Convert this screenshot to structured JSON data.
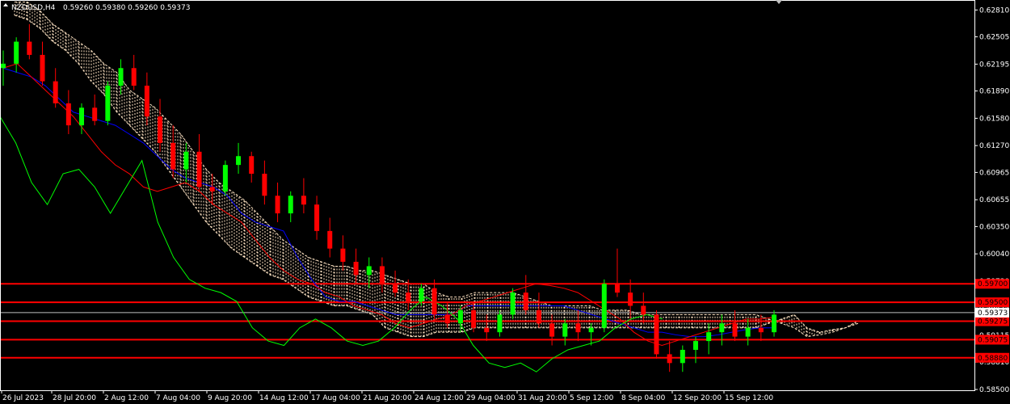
{
  "chart_data": {
    "type": "candlestick",
    "header": {
      "symbol_tf": "NZDUSD,H4",
      "ohlc": "0.59260 0.59380 0.59260 0.59373"
    },
    "y_ticks": [
      "0.62810",
      "0.62505",
      "0.62195",
      "0.61890",
      "0.61580",
      "0.61270",
      "0.60965",
      "0.60655",
      "0.60350",
      "0.60040",
      "0.59730",
      "0.59425",
      "0.59115",
      "0.58810",
      "0.58500"
    ],
    "y_range": [
      0.585,
      0.62905
    ],
    "x_ticks": [
      "26 Jul 2023",
      "28 Jul 20:00",
      "2 Aug 12:00",
      "7 Aug 04:00",
      "9 Aug 20:00",
      "14 Aug 12:00",
      "17 Aug 04:00",
      "21 Aug 20:00",
      "24 Aug 12:00",
      "29 Aug 04:00",
      "31 Aug 20:00",
      "5 Sep 12:00",
      "8 Sep 04:00",
      "12 Sep 20:00",
      "15 Sep 12:00"
    ],
    "current_price": "0.59373",
    "horizontal_levels": [
      {
        "label": "0.59700",
        "value": 0.597
      },
      {
        "label": "0.59500",
        "value": 0.5949
      },
      {
        "label": "0.59275",
        "value": 0.59275
      },
      {
        "label": "0.59075",
        "value": 0.59065
      },
      {
        "label": "0.58880",
        "value": 0.5886
      }
    ],
    "colors": {
      "background": "#000000",
      "bull": "#00ff00",
      "bear": "#ff0000",
      "tenkan": "#ff0000",
      "kijun": "#0000ff",
      "chikou": "#00ff00",
      "cloud": "#ffe4c4",
      "level_line": "#ff0000",
      "label_bg": "#ff0000"
    },
    "tenkan": [
      0.6215,
      0.622,
      0.6205,
      0.619,
      0.6175,
      0.616,
      0.614,
      0.612,
      0.6105,
      0.6095,
      0.608,
      0.6075,
      0.608,
      0.6085,
      0.6075,
      0.606,
      0.605,
      0.604,
      0.602,
      0.6,
      0.5985,
      0.5975,
      0.597,
      0.596,
      0.5955,
      0.5945,
      0.594,
      0.5935,
      0.5925,
      0.592,
      0.5925,
      0.593,
      0.5935,
      0.5945,
      0.595,
      0.5955,
      0.596,
      0.5965,
      0.597,
      0.5968,
      0.5965,
      0.596,
      0.595,
      0.594,
      0.593,
      0.5915,
      0.5905,
      0.59,
      0.5905,
      0.591,
      0.5915,
      0.592,
      0.5925,
      0.593,
      0.593,
      0.5932
    ],
    "kijun": [
      0.6215,
      0.621,
      0.6205,
      0.6195,
      0.618,
      0.6165,
      0.616,
      0.6155,
      0.615,
      0.614,
      0.613,
      0.6115,
      0.61,
      0.609,
      0.6085,
      0.608,
      0.607,
      0.605,
      0.604,
      0.6035,
      0.603,
      0.6,
      0.5975,
      0.5955,
      0.595,
      0.595,
      0.5945,
      0.594,
      0.5935,
      0.5935,
      0.5935,
      0.5935,
      0.5935,
      0.5945,
      0.5945,
      0.5945,
      0.5945,
      0.5945,
      0.5945,
      0.5945,
      0.5945,
      0.594,
      0.5935,
      0.593,
      0.5925,
      0.592,
      0.5915,
      0.5915,
      0.5912,
      0.591,
      0.591,
      0.5912,
      0.5915,
      0.5918,
      0.592,
      0.592
    ],
    "chikou": [
      0.616,
      0.613,
      0.6085,
      0.606,
      0.6095,
      0.61,
      0.608,
      0.605,
      0.608,
      0.611,
      0.604,
      0.6,
      0.5975,
      0.5965,
      0.596,
      0.595,
      0.592,
      0.5905,
      0.59,
      0.592,
      0.593,
      0.592,
      0.5905,
      0.59,
      0.5905,
      0.592,
      0.594,
      0.5955,
      0.5945,
      0.593,
      0.59,
      0.588,
      0.5875,
      0.588,
      0.587,
      0.5885,
      0.5895,
      0.59,
      0.5905,
      0.592,
      0.593,
      0.5935,
      0.593
    ],
    "senkou_a": [
      0.6275,
      0.627,
      0.626,
      0.6245,
      0.6235,
      0.622,
      0.62,
      0.6185,
      0.6165,
      0.615,
      0.6135,
      0.612,
      0.61,
      0.608,
      0.606,
      0.604,
      0.6025,
      0.601,
      0.6,
      0.599,
      0.598,
      0.5975,
      0.5965,
      0.5955,
      0.595,
      0.5945,
      0.5945,
      0.594,
      0.5935,
      0.592,
      0.5915,
      0.591,
      0.591,
      0.5915,
      0.5915,
      0.5915,
      0.592,
      0.592,
      0.592,
      0.592,
      0.592,
      0.592,
      0.592,
      0.592,
      0.592,
      0.592,
      0.592,
      0.592,
      0.592,
      0.592,
      0.592,
      0.592,
      0.592,
      0.592,
      0.592,
      0.592,
      0.592,
      0.592,
      0.592,
      0.5925,
      0.593,
      0.5935,
      0.592,
      0.5915,
      0.5918,
      0.592,
      0.5925
    ],
    "senkou_b": [
      0.629,
      0.629,
      0.628,
      0.6265,
      0.6255,
      0.6245,
      0.6235,
      0.622,
      0.621,
      0.619,
      0.618,
      0.617,
      0.6155,
      0.614,
      0.612,
      0.61,
      0.6085,
      0.6075,
      0.6065,
      0.605,
      0.6035,
      0.602,
      0.601,
      0.6,
      0.5995,
      0.599,
      0.599,
      0.5985,
      0.5985,
      0.598,
      0.5975,
      0.597,
      0.597,
      0.596,
      0.5955,
      0.5955,
      0.596,
      0.596,
      0.596,
      0.596,
      0.5955,
      0.595,
      0.5945,
      0.5945,
      0.5945,
      0.5945,
      0.594,
      0.594,
      0.594,
      0.5935,
      0.5935,
      0.5935,
      0.5935,
      0.5935,
      0.5935,
      0.5935,
      0.5935,
      0.5935,
      0.5935,
      0.593,
      0.5925,
      0.592,
      0.591,
      0.5912,
      0.5915,
      0.592,
      0.5928
    ],
    "candles": [
      [
        0.6215,
        0.6235,
        0.6195,
        0.622
      ],
      [
        0.622,
        0.625,
        0.621,
        0.6245
      ],
      [
        0.6245,
        0.6265,
        0.6225,
        0.623
      ],
      [
        0.623,
        0.6245,
        0.6195,
        0.62
      ],
      [
        0.62,
        0.6215,
        0.617,
        0.6175
      ],
      [
        0.6175,
        0.619,
        0.614,
        0.615
      ],
      [
        0.615,
        0.6175,
        0.614,
        0.617
      ],
      [
        0.617,
        0.6185,
        0.615,
        0.6155
      ],
      [
        0.6155,
        0.62,
        0.615,
        0.6195
      ],
      [
        0.6195,
        0.6225,
        0.6185,
        0.6215
      ],
      [
        0.6215,
        0.623,
        0.619,
        0.6195
      ],
      [
        0.6195,
        0.621,
        0.615,
        0.616
      ],
      [
        0.616,
        0.618,
        0.612,
        0.613
      ],
      [
        0.613,
        0.615,
        0.609,
        0.61
      ],
      [
        0.61,
        0.613,
        0.6085,
        0.612
      ],
      [
        0.612,
        0.614,
        0.6075,
        0.608
      ],
      [
        0.608,
        0.6095,
        0.606,
        0.6075
      ],
      [
        0.6075,
        0.611,
        0.607,
        0.6105
      ],
      [
        0.6105,
        0.613,
        0.6095,
        0.6115
      ],
      [
        0.6115,
        0.612,
        0.6085,
        0.6095
      ],
      [
        0.6095,
        0.611,
        0.606,
        0.607
      ],
      [
        0.607,
        0.6085,
        0.604,
        0.605
      ],
      [
        0.605,
        0.6075,
        0.604,
        0.607
      ],
      [
        0.607,
        0.609,
        0.605,
        0.606
      ],
      [
        0.606,
        0.607,
        0.602,
        0.603
      ],
      [
        0.603,
        0.6045,
        0.6,
        0.601
      ],
      [
        0.601,
        0.6025,
        0.5985,
        0.5995
      ],
      [
        0.5995,
        0.601,
        0.597,
        0.598
      ],
      [
        0.598,
        0.6,
        0.5965,
        0.599
      ],
      [
        0.599,
        0.6,
        0.596,
        0.597
      ],
      [
        0.597,
        0.5985,
        0.5955,
        0.596
      ],
      [
        0.596,
        0.5975,
        0.594,
        0.595
      ],
      [
        0.595,
        0.597,
        0.5945,
        0.5965
      ],
      [
        0.5965,
        0.5975,
        0.593,
        0.5935
      ],
      [
        0.5935,
        0.595,
        0.592,
        0.5925
      ],
      [
        0.5925,
        0.5945,
        0.5915,
        0.594
      ],
      [
        0.594,
        0.595,
        0.5915,
        0.592
      ],
      [
        0.592,
        0.5935,
        0.5905,
        0.5915
      ],
      [
        0.5915,
        0.594,
        0.591,
        0.5935
      ],
      [
        0.5935,
        0.5965,
        0.593,
        0.596
      ],
      [
        0.596,
        0.598,
        0.5935,
        0.594
      ],
      [
        0.594,
        0.596,
        0.592,
        0.5925
      ],
      [
        0.5925,
        0.5935,
        0.59,
        0.591
      ],
      [
        0.591,
        0.593,
        0.59,
        0.5925
      ],
      [
        0.5925,
        0.594,
        0.5905,
        0.5915
      ],
      [
        0.5915,
        0.5925,
        0.59,
        0.592
      ],
      [
        0.592,
        0.5975,
        0.5915,
        0.597
      ],
      [
        0.597,
        0.601,
        0.5955,
        0.596
      ],
      [
        0.596,
        0.5975,
        0.593,
        0.5945
      ],
      [
        0.5945,
        0.596,
        0.5925,
        0.5935
      ],
      [
        0.5935,
        0.594,
        0.5885,
        0.589
      ],
      [
        0.589,
        0.5905,
        0.587,
        0.588
      ],
      [
        0.588,
        0.59,
        0.587,
        0.5895
      ],
      [
        0.5895,
        0.591,
        0.588,
        0.5905
      ],
      [
        0.5905,
        0.5925,
        0.589,
        0.5915
      ],
      [
        0.5915,
        0.5935,
        0.59,
        0.5925
      ],
      [
        0.5925,
        0.594,
        0.5905,
        0.591
      ],
      [
        0.591,
        0.593,
        0.59,
        0.592
      ],
      [
        0.592,
        0.5935,
        0.5905,
        0.5915
      ],
      [
        0.5915,
        0.594,
        0.591,
        0.5935
      ]
    ]
  }
}
